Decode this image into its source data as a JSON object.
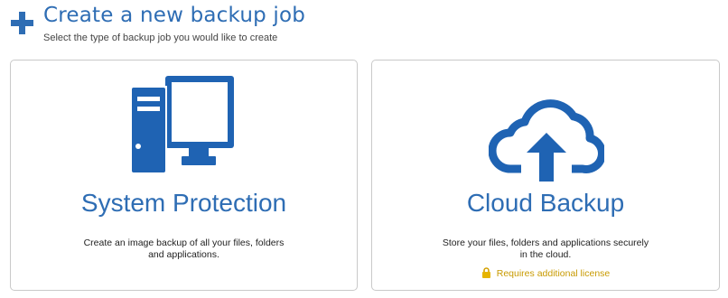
{
  "header": {
    "icon": "plus-icon",
    "title": "Create a new backup job",
    "subtitle": "Select the type of backup job you would like to create"
  },
  "cards": [
    {
      "icon": "computer-tower-monitor-icon",
      "title": "System Protection",
      "description_line1": "Create an image backup of all your files, folders",
      "description_line2": "and applications."
    },
    {
      "icon": "cloud-upload-icon",
      "title": "Cloud Backup",
      "description_line1": "Store your files, folders and applications securely",
      "description_line2": "in the cloud.",
      "license_icon": "lock-icon",
      "license_text": "Requires additional license"
    }
  ],
  "colors": {
    "accent": "#2e6db4",
    "icon_blue": "#1f63b3",
    "license": "#c89a00",
    "border": "#c9c9c9"
  }
}
